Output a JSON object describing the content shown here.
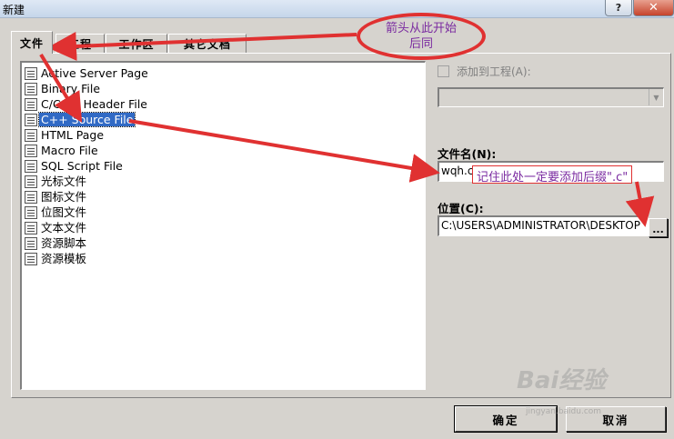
{
  "window": {
    "title": "新建",
    "help_label": "?",
    "close_label": "✕"
  },
  "tabs": [
    {
      "label": "文件",
      "active": true
    },
    {
      "label": "工程",
      "active": false
    },
    {
      "label": "工作区",
      "active": false
    },
    {
      "label": "其它文档",
      "active": false
    }
  ],
  "file_types": [
    {
      "label": "Active Server Page",
      "icon": "asp-page-icon"
    },
    {
      "label": "Binary File",
      "icon": "binary-file-icon"
    },
    {
      "label": "C/C++ Header File",
      "icon": "header-file-icon"
    },
    {
      "label": "C++ Source File",
      "icon": "source-file-icon",
      "selected": true
    },
    {
      "label": "HTML Page",
      "icon": "html-page-icon"
    },
    {
      "label": "Macro File",
      "icon": "macro-file-icon"
    },
    {
      "label": "SQL Script File",
      "icon": "sql-file-icon"
    },
    {
      "label": "光标文件",
      "icon": "cursor-file-icon"
    },
    {
      "label": "图标文件",
      "icon": "icon-file-icon"
    },
    {
      "label": "位图文件",
      "icon": "bitmap-file-icon"
    },
    {
      "label": "文本文件",
      "icon": "text-file-icon"
    },
    {
      "label": "资源脚本",
      "icon": "resource-script-icon"
    },
    {
      "label": "资源模板",
      "icon": "resource-template-icon"
    }
  ],
  "options": {
    "add_to_project_label": "添加到工程(A):",
    "project_combo_value": "",
    "filename_label": "文件名(N):",
    "filename_value": "wqh.c",
    "location_label": "位置(C):",
    "location_value": "C:\\USERS\\ADMINISTRATOR\\DESKTOP",
    "browse_label": "..."
  },
  "buttons": {
    "ok": "确定",
    "cancel": "取消"
  },
  "annotations": {
    "oval_line1": "箭头从此开始",
    "oval_line2": "后同",
    "note": "记住此处一定要添加后缀\".c\""
  },
  "watermark": {
    "text": "Bai经验",
    "sub": "jingyan.baidu.com"
  },
  "colors": {
    "selection": "#316ac5",
    "annotation_red": "#e03131",
    "annotation_text": "#7a2aa0"
  }
}
